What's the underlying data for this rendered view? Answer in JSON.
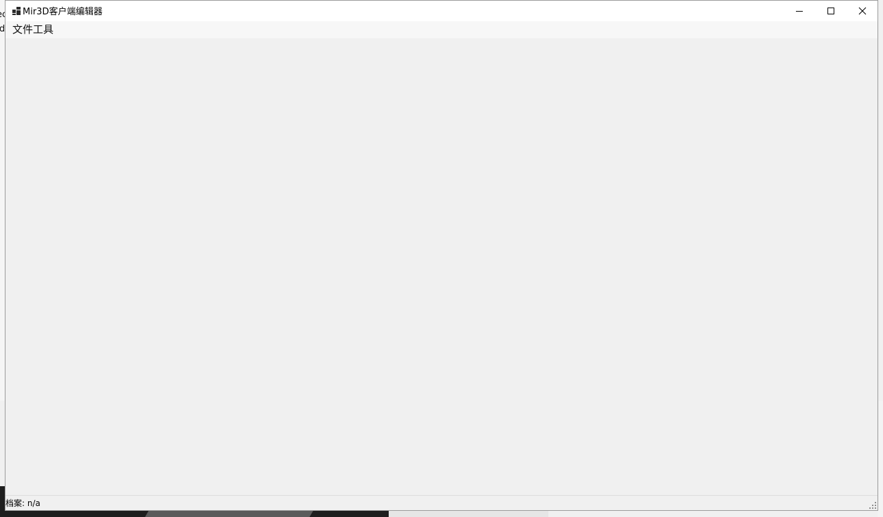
{
  "window": {
    "title": "Mir3D客户端编辑器",
    "icon": "app-windows-icon",
    "controls": {
      "minimize_icon": "minimize-icon",
      "maximize_icon": "maximize-icon",
      "close_icon": "close-icon"
    }
  },
  "menubar": {
    "items": [
      {
        "label": "文件工具"
      }
    ]
  },
  "statusbar": {
    "label": "档案:",
    "value": "n/a",
    "grip_icon": "resize-grip-icon"
  },
  "background": {
    "left_fragments": [
      "ec",
      "d"
    ]
  },
  "colors": {
    "titlebar": "#ffffff",
    "menubar": "#f7f7f7",
    "client": "#f0f0f0",
    "text": "#000000"
  }
}
